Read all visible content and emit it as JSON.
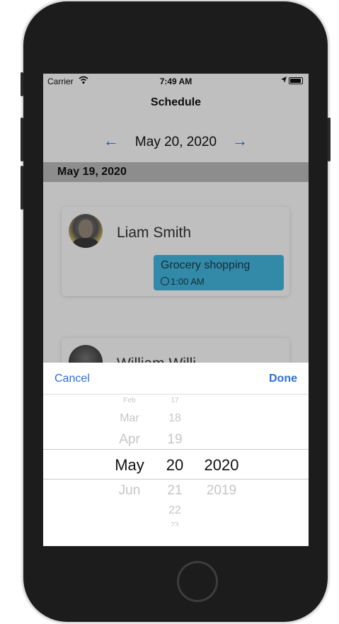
{
  "status_bar": {
    "carrier": "Carrier",
    "time": "7:49 AM"
  },
  "nav": {
    "title": "Schedule"
  },
  "date_nav": {
    "prev_icon": "arrow-left-icon",
    "next_icon": "arrow-right-icon",
    "date": "May 20, 2020"
  },
  "section": {
    "header": "May 19, 2020"
  },
  "cards": [
    {
      "name": "Liam Smith",
      "event": {
        "title": "Grocery shopping",
        "time": "1:00 AM"
      }
    },
    {
      "name": "William Willi"
    }
  ],
  "picker": {
    "cancel": "Cancel",
    "done": "Done",
    "months": [
      "Feb",
      "Mar",
      "Apr",
      "May",
      "Jun"
    ],
    "days": [
      "17",
      "18",
      "19",
      "20",
      "21",
      "22",
      "23"
    ],
    "years": [
      "2020",
      "2019"
    ],
    "selected": {
      "month": "May",
      "day": "20",
      "year": "2020"
    }
  },
  "colors": {
    "accent": "#2a6fdb",
    "event_pill": "#45b9e0",
    "section_header": "#bdbdbd"
  }
}
